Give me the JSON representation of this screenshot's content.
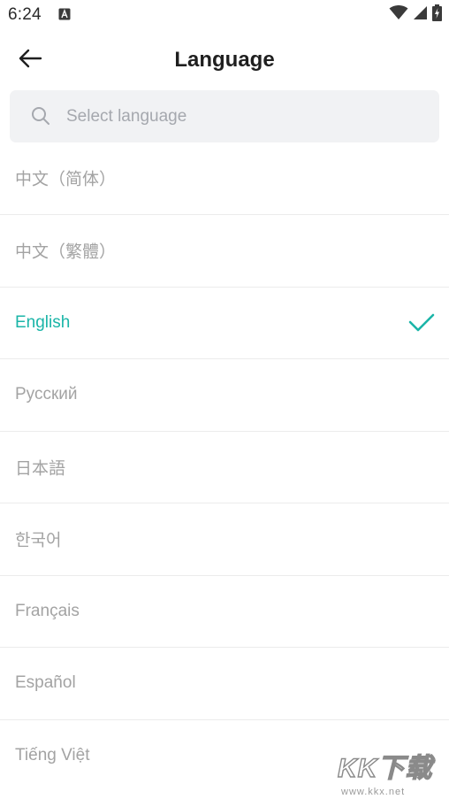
{
  "status_bar": {
    "time": "6:24",
    "notification_icon": "a-box-icon",
    "icons": [
      "wifi-icon",
      "signal-icon",
      "battery-charging-icon"
    ]
  },
  "header": {
    "back_icon": "arrow-left-icon",
    "title": "Language"
  },
  "search": {
    "icon": "search-icon",
    "placeholder": "Select language",
    "value": ""
  },
  "languages": [
    {
      "label": "中文（简体）",
      "selected": false
    },
    {
      "label": "中文（繁體）",
      "selected": false
    },
    {
      "label": "English",
      "selected": true
    },
    {
      "label": "Русский",
      "selected": false
    },
    {
      "label": "日本語",
      "selected": false
    },
    {
      "label": "한국어",
      "selected": false
    },
    {
      "label": "Français",
      "selected": false
    },
    {
      "label": "Español",
      "selected": false
    },
    {
      "label": "Tiếng Việt",
      "selected": false
    }
  ],
  "selected_check_icon": "checkmark-icon",
  "colors": {
    "accent": "#1bb5a8",
    "text_muted": "#a3a3a3",
    "search_bg": "#f1f2f4"
  },
  "watermark": {
    "text": "KK下载",
    "url": "www.kkx.net"
  }
}
